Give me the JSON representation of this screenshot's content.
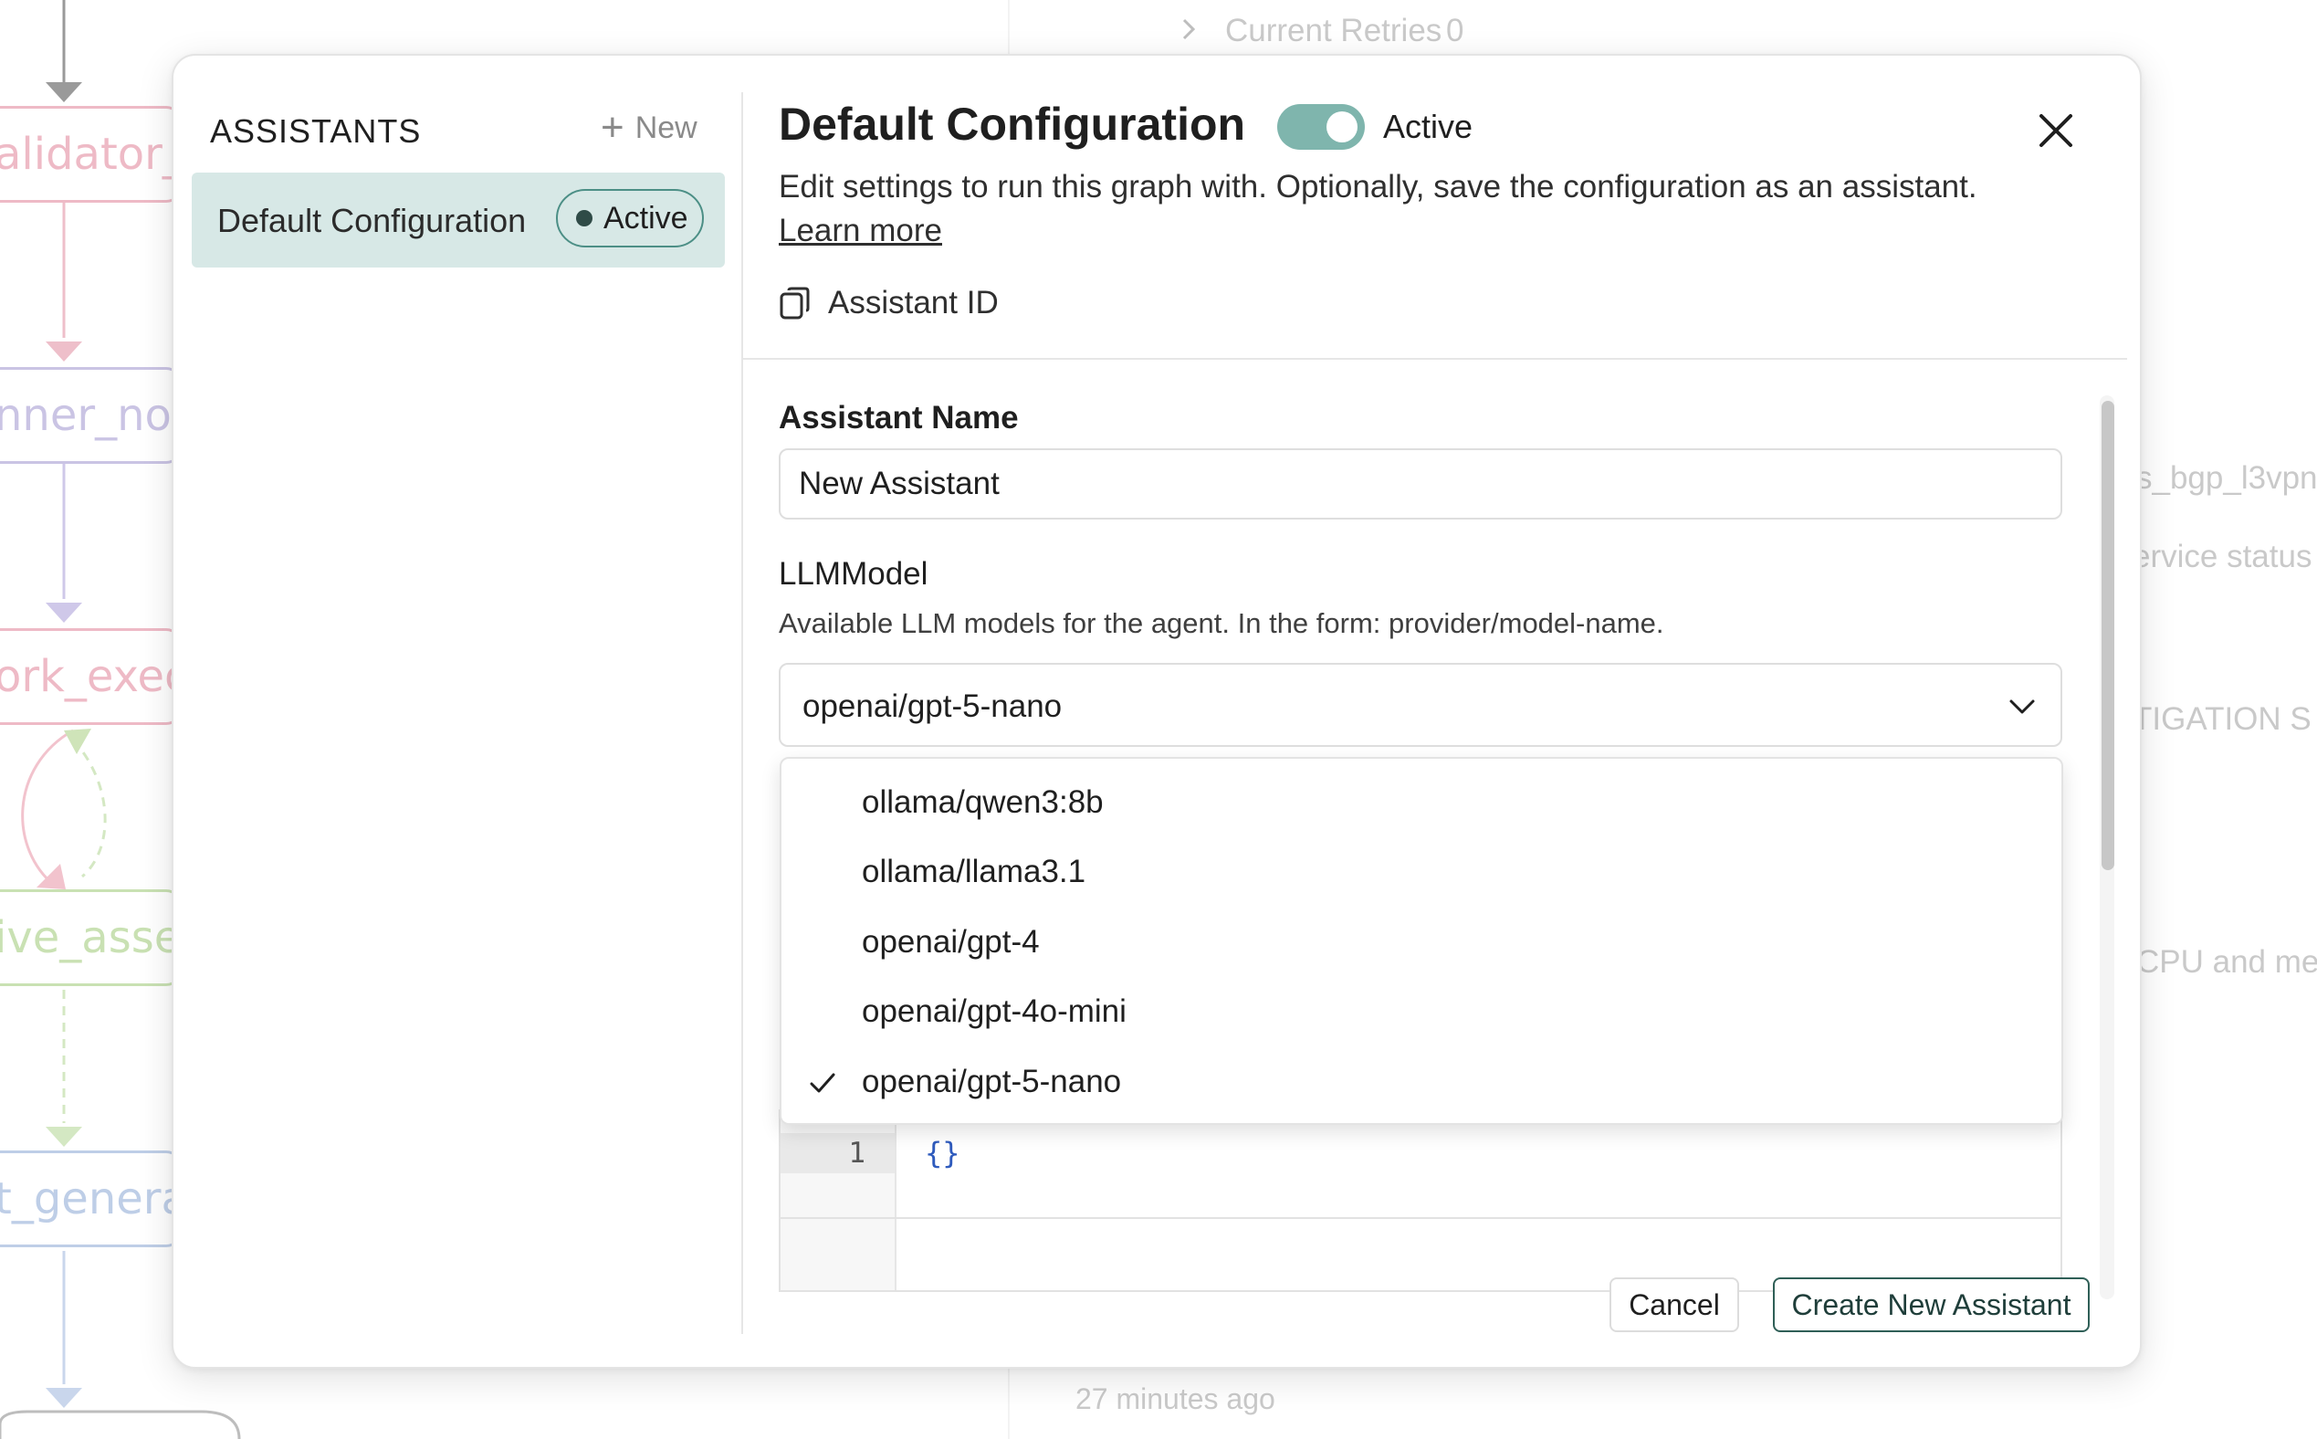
{
  "background": {
    "nodes": [
      {
        "label": "alidator_",
        "color": "#e9a3b3"
      },
      {
        "label": "nner_nod",
        "color": "#b9b1dc"
      },
      {
        "label": "ork_exec",
        "color": "#e9a3b3"
      },
      {
        "label": "ive_asse",
        "color": "#b7d89a"
      },
      {
        "label": "t_genera",
        "color": "#a9bedf"
      }
    ],
    "top_text": "Current Retries",
    "top_count": "0",
    "right_texts": [
      "s_bgp_l3vpn",
      "ervice status",
      "TIGATION S",
      "CPU and me"
    ],
    "bottom_timestamp": "27 minutes ago"
  },
  "sidebar": {
    "heading": "ASSISTANTS",
    "new_label": "New",
    "items": [
      {
        "label": "Default Configuration",
        "badge": "Active"
      }
    ]
  },
  "header": {
    "title": "Default Configuration",
    "toggle_label": "Active",
    "toggle_on": true,
    "description": "Edit settings to run this graph with. Optionally, save the configuration as an assistant.",
    "learn_more": "Learn more",
    "assistant_id_label": "Assistant ID"
  },
  "form": {
    "name_label": "Assistant Name",
    "name_value": "New Assistant",
    "model_label": "LLMModel",
    "model_help": "Available LLM models for the agent. In the form: provider/model-name.",
    "model_value": "openai/gpt-5-nano",
    "model_options": [
      {
        "label": "ollama/qwen3:8b",
        "selected": false
      },
      {
        "label": "ollama/llama3.1",
        "selected": false
      },
      {
        "label": "openai/gpt-4",
        "selected": false
      },
      {
        "label": "openai/gpt-4o-mini",
        "selected": false
      },
      {
        "label": "openai/gpt-5-nano",
        "selected": true
      }
    ],
    "code_line_number": "1",
    "code_content": "{}"
  },
  "footer": {
    "cancel_label": "Cancel",
    "create_label": "Create New Assistant"
  },
  "colors": {
    "accent": "#7fb5ad",
    "selected_bg": "#d7e8e6",
    "badge_border": "#4c8f86",
    "primary_border": "#2f5f57"
  }
}
